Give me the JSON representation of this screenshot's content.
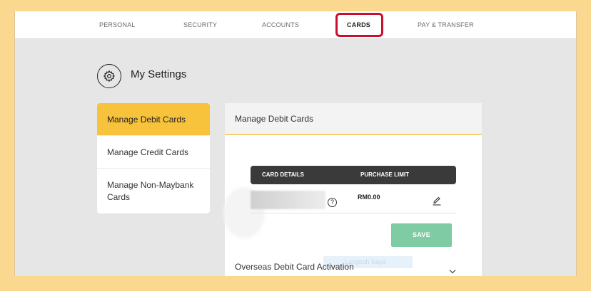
{
  "nav": {
    "items": [
      {
        "label": "PERSONAL"
      },
      {
        "label": "SECURITY"
      },
      {
        "label": "ACCOUNTS"
      },
      {
        "label": "CARDS"
      },
      {
        "label": "PAY & TRANSFER"
      }
    ],
    "active": "CARDS",
    "highlight_color": "#c8102e"
  },
  "settings": {
    "title": "My Settings",
    "icon": "gear-icon"
  },
  "sidebar": {
    "items": [
      {
        "label": "Manage Debit Cards"
      },
      {
        "label": "Manage Credit Cards"
      },
      {
        "label": "Manage Non-Maybank Cards"
      }
    ],
    "active_color": "#f7c23c"
  },
  "panel": {
    "title": "Manage Debit Cards",
    "table": {
      "headers": [
        "CARD DETAILS",
        "PURCHASE LIMIT"
      ],
      "rows": [
        {
          "purchase_limit": "RM0.00"
        }
      ]
    },
    "save_label": "SAVE",
    "save_color": "#7ecba4",
    "ghost_tag": "Langkah Saya",
    "overseas_label": "Overseas Debit Card Activation"
  },
  "colors": {
    "page_border": "#fbd88f",
    "background": "#e6e6e6"
  }
}
